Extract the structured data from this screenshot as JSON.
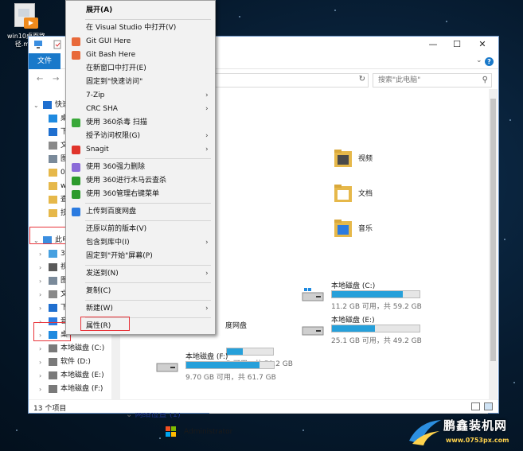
{
  "desktop": {
    "icon_label": "win10桌面路径.mp4"
  },
  "window": {
    "ribbon": {
      "file_tab": "文件"
    },
    "search": {
      "placeholder": "搜索\"此电脑\""
    },
    "status": {
      "count": "13 个项目"
    },
    "nav": [
      {
        "label": "快速",
        "icon": "star-icon",
        "level": 0,
        "caret": "⌄"
      },
      {
        "label": "桌",
        "icon": "desktop-icon",
        "level": 1
      },
      {
        "label": "下",
        "icon": "download-icon",
        "level": 1
      },
      {
        "label": "文",
        "icon": "document-icon",
        "level": 1
      },
      {
        "label": "图",
        "icon": "picture-icon",
        "level": 1
      },
      {
        "label": "00",
        "icon": "folder-icon",
        "level": 1
      },
      {
        "label": "wi",
        "icon": "folder-icon",
        "level": 1
      },
      {
        "label": "查",
        "icon": "folder-icon",
        "level": 1
      },
      {
        "label": "技",
        "icon": "folder-icon",
        "level": 1
      },
      {
        "label": "此电",
        "icon": "computer-icon",
        "level": 0,
        "caret": "⌄"
      },
      {
        "label": "3D",
        "icon": "cube-icon",
        "level": 1,
        "caret": "›"
      },
      {
        "label": "视",
        "icon": "video-icon",
        "level": 1,
        "caret": "›"
      },
      {
        "label": "图",
        "icon": "picture-icon",
        "level": 1,
        "caret": "›"
      },
      {
        "label": "文",
        "icon": "document-icon",
        "level": 1,
        "caret": "›"
      },
      {
        "label": "下",
        "icon": "download-icon",
        "level": 1,
        "caret": "›"
      },
      {
        "label": "音",
        "icon": "music-icon",
        "level": 1,
        "caret": "›"
      },
      {
        "label": "桌",
        "icon": "desktop-icon",
        "level": 1,
        "caret": "›"
      },
      {
        "label": "本地磁盘 (C:)",
        "icon": "drive-icon",
        "level": 1,
        "caret": "›"
      },
      {
        "label": "软件 (D:)",
        "icon": "drive-icon",
        "level": 1,
        "caret": "›"
      },
      {
        "label": "本地磁盘 (E:)",
        "icon": "drive-icon",
        "level": 1,
        "caret": "›"
      },
      {
        "label": "本地磁盘 (F:)",
        "icon": "drive-icon",
        "level": 1,
        "caret": "›"
      }
    ],
    "folders": [
      {
        "label": "视频",
        "icon": "video-folder-icon"
      },
      {
        "label": "文档",
        "icon": "document-folder-icon"
      },
      {
        "label": "音乐",
        "icon": "music-folder-icon"
      }
    ],
    "partial_drive_label": "度网盘",
    "drives": [
      {
        "name": "本地磁盘 (C:)",
        "space": "11.2 GB 可用，共 59.2 GB",
        "used_fraction": 0.81
      },
      {
        "name": "本地磁盘 (E:)",
        "space": "25.1 GB 可用，共 49.2 GB",
        "used_fraction": 0.49
      },
      {
        "name": "本地磁盘 (F:)",
        "space": "9.70 GB 可用，共 61.7 GB",
        "used_fraction": 0.84
      }
    ],
    "partial_drive_space": "B 可用，共 59.2 GB",
    "network": {
      "header": "网络位置 (1)",
      "item": "Administrator"
    }
  },
  "context_menu": [
    {
      "label": "展开(A)",
      "bold": true
    },
    {
      "sep": true
    },
    {
      "label": "在 Visual Studio 中打开(V)"
    },
    {
      "label": "Git GUI Here",
      "icon": "git-gui-icon",
      "color": "#e8693a"
    },
    {
      "label": "Git Bash Here",
      "icon": "git-bash-icon",
      "color": "#e8693a"
    },
    {
      "label": "在新窗口中打开(E)"
    },
    {
      "label": "固定到\"快速访问\""
    },
    {
      "label": "7-Zip",
      "submenu": true
    },
    {
      "label": "CRC SHA",
      "submenu": true
    },
    {
      "label": "使用 360杀毒 扫描",
      "icon": "shield-360-icon",
      "color": "#3aa83a"
    },
    {
      "label": "授予访问权限(G)",
      "submenu": true
    },
    {
      "label": "Snagit",
      "icon": "snagit-icon",
      "color": "#e0342b",
      "submenu": true
    },
    {
      "sep": true
    },
    {
      "label": "使用 360强力删除",
      "icon": "delete-360-icon",
      "color": "#8a6ad8"
    },
    {
      "label": "使用 360进行木马云查杀",
      "icon": "trojan-360-icon",
      "color": "#2c9a2c"
    },
    {
      "label": "使用 360管理右键菜单",
      "icon": "menu-360-icon",
      "color": "#2c9a2c"
    },
    {
      "sep": true
    },
    {
      "label": "上传到百度网盘",
      "icon": "baidu-cloud-icon",
      "color": "#2b7be0"
    },
    {
      "sep": true
    },
    {
      "label": "还原以前的版本(V)"
    },
    {
      "label": "包含到库中(I)",
      "submenu": true
    },
    {
      "label": "固定到\"开始\"屏幕(P)"
    },
    {
      "sep": true
    },
    {
      "label": "发送到(N)",
      "submenu": true
    },
    {
      "sep": true
    },
    {
      "label": "复制(C)"
    },
    {
      "sep": true
    },
    {
      "label": "新建(W)",
      "submenu": true
    },
    {
      "sep": true
    },
    {
      "label": "属性(R)"
    }
  ],
  "watermark": {
    "name": "鹏鑫装机网",
    "url": "www.0753px.com"
  },
  "colors": {
    "accent": "#1979ca",
    "drive_fill": "#26a0da",
    "highlight": "#e8343a"
  }
}
